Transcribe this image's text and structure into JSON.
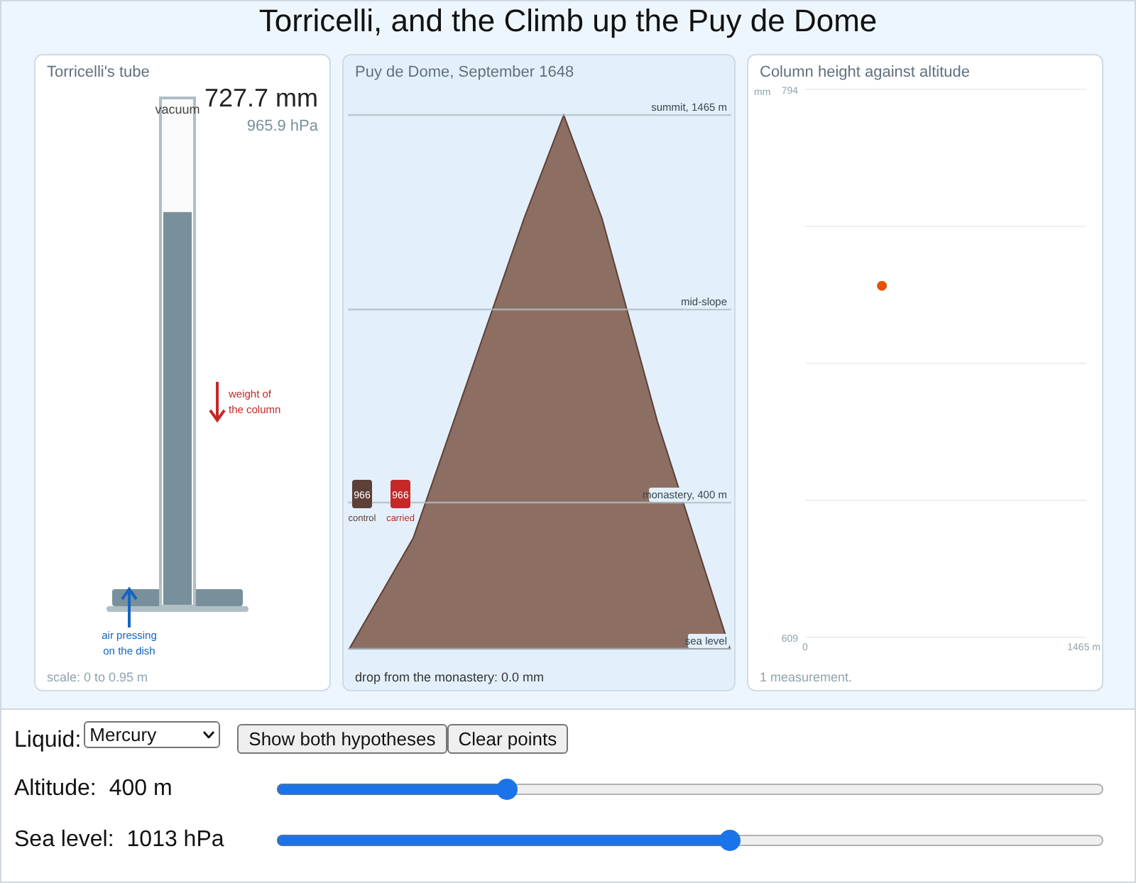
{
  "title": "Torricelli, and the Climb up the Puy de Dome",
  "tube_panel": {
    "title": "Torricelli's tube",
    "reading": "727.7 mm",
    "pressure": "965.9 hPa",
    "vacuum_label": "vacuum",
    "level": 0.777,
    "weight_label": [
      "weight of",
      "the column"
    ],
    "air_label": [
      "air pressing",
      "on the dish"
    ],
    "scale": "scale: 0 to 0.95 m"
  },
  "mountain_panel": {
    "title": "Puy de Dome, September 1648",
    "lines": [
      {
        "label": "summit, 1465 m"
      },
      {
        "label": "mid-slope"
      },
      {
        "label": "monastery, 400 m"
      },
      {
        "label": "sea level"
      }
    ],
    "samples": [
      {
        "value": "966",
        "label": "control",
        "color": "#5d4037"
      },
      {
        "value": "966",
        "label": "carried",
        "color": "#c62828"
      }
    ],
    "footer": "drop from the monastery: 0.0 mm"
  },
  "chart_panel": {
    "footer": "1 measurement.",
    "chart_data": {
      "type": "scatter",
      "title": "Column height against altitude",
      "ylabel": "mm",
      "x": [
        400
      ],
      "values": [
        727.7
      ],
      "xlim": [
        0,
        1465
      ],
      "ylim": [
        609,
        794
      ],
      "xticks": [
        {
          "value": 0,
          "label": "0"
        },
        {
          "value": 1465,
          "label": "1465 m"
        }
      ],
      "yticks": [
        609,
        794
      ]
    }
  },
  "controls": {
    "liquid_label": "Liquid:",
    "liquid": "Mercury",
    "buttons": [
      "Show both hypotheses",
      "Clear points"
    ],
    "sliders": [
      {
        "label": "Altitude:",
        "reading": "400 m",
        "level": 0.273
      },
      {
        "label": "Sea level:",
        "reading": "1013 hPa",
        "level": 0.55
      }
    ]
  }
}
